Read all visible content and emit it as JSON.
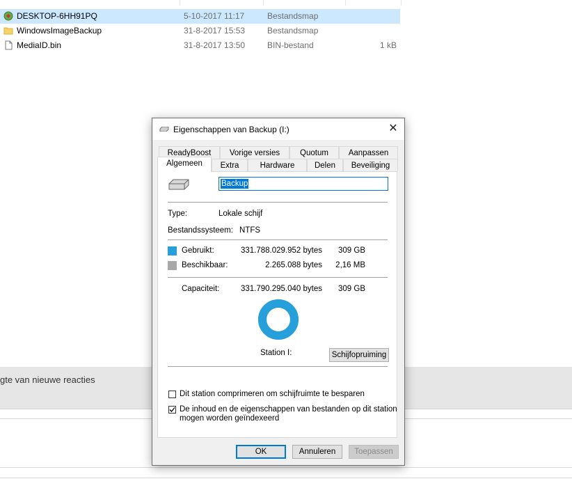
{
  "explorer": {
    "files": [
      {
        "name": "DESKTOP-6HH91PQ",
        "date": "5-10-2017 11:17",
        "type": "Bestandsmap",
        "size": "",
        "icon": "backup-folder-icon",
        "selected": true
      },
      {
        "name": "WindowsImageBackup",
        "date": "31-8-2017 15:53",
        "type": "Bestandsmap",
        "size": "",
        "icon": "folder-icon",
        "selected": false
      },
      {
        "name": "MediaID.bin",
        "date": "31-8-2017 13:50",
        "type": "BIN-bestand",
        "size": "1 kB",
        "icon": "file-icon",
        "selected": false
      }
    ]
  },
  "background_page": {
    "band_text": "gte van nieuwe reacties"
  },
  "dialog": {
    "title": "Eigenschappen van Backup (I:)",
    "close_glyph": "✕",
    "tabs_row1": [
      "ReadyBoost",
      "Vorige versies",
      "Quotum",
      "Aanpassen"
    ],
    "tabs_row2": [
      "Algemeen",
      "Extra",
      "Hardware",
      "Delen",
      "Beveiliging"
    ],
    "active_tab": "Algemeen",
    "name_value": "Backup",
    "type_label": "Type:",
    "type_value": "Lokale schijf",
    "fs_label": "Bestandssysteem:",
    "fs_value": "NTFS",
    "used_label": "Gebruikt:",
    "used_bytes": "331.788.029.952 bytes",
    "used_size": "309 GB",
    "free_label": "Beschikbaar:",
    "free_bytes": "2.265.088 bytes",
    "free_size": "2,16 MB",
    "cap_label": "Capaciteit:",
    "cap_bytes": "331.790.295.040 bytes",
    "cap_size": "309 GB",
    "used_fraction": 0.99999,
    "station_label": "Station I:",
    "cleanup_button": "Schijfopruiming",
    "compress_label": "Dit station comprimeren om schijfruimte te besparen",
    "compress_checked": false,
    "index_label_line1": "De inhoud en de eigenschappen van bestanden op dit station",
    "index_label_line2": "mogen worden geïndexeerd",
    "index_checked": true,
    "ok_button": "OK",
    "cancel_button": "Annuleren",
    "apply_button": "Toepassen",
    "colors": {
      "used": "#26a0da",
      "free": "#a8a8a8",
      "selection": "#cce8ff",
      "accent": "#0078d7"
    }
  }
}
